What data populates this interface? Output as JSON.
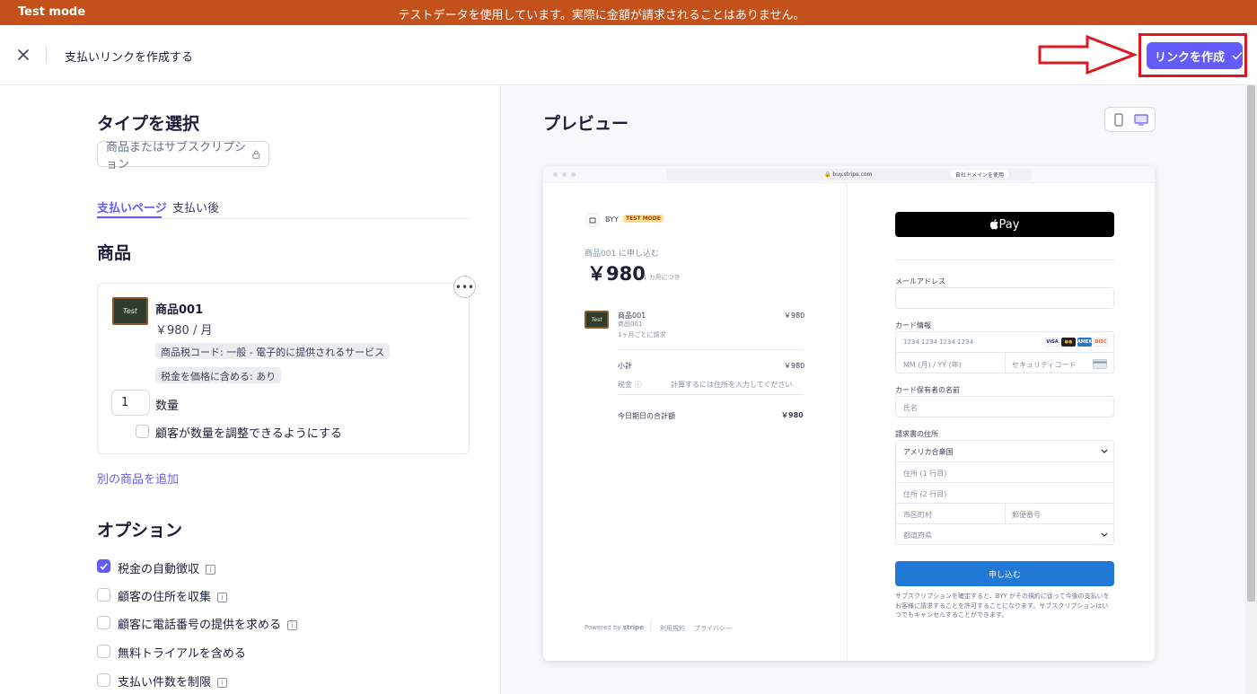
{
  "banner": {
    "mode": "Test mode",
    "message": "テストデータを使用しています。実際に金額が請求されることはありません。"
  },
  "header": {
    "title": "支払いリンクを作成する",
    "create_button": "リンクを作成"
  },
  "left": {
    "type_heading": "タイプを選択",
    "type_chip": "商品またはサブスクリプション",
    "tabs": [
      {
        "label": "支払いページ",
        "active": true
      },
      {
        "label": "支払い後",
        "active": false
      }
    ],
    "product_heading": "商品",
    "product": {
      "thumb_text": "Test",
      "name": "商品001",
      "price": "￥980 / 月",
      "tags": [
        "商品税コード: 一般 - 電子的に提供されるサービス",
        "税金を価格に含める: あり"
      ],
      "quantity_value": "1",
      "quantity_label": "数量",
      "adjust_quantity_label": "顧客が数量を調整できるようにする"
    },
    "add_product_link": "別の商品を追加",
    "options_heading": "オプション",
    "options": [
      {
        "label": "税金の自動徴収",
        "checked": true
      },
      {
        "label": "顧客の住所を収集",
        "checked": false
      },
      {
        "label": "顧客に電話番号の提供を求める",
        "checked": false
      },
      {
        "label": "無料トライアルを含める",
        "checked": false
      },
      {
        "label": "支払い件数を制限",
        "checked": false
      }
    ]
  },
  "preview": {
    "heading": "プレビュー",
    "browser": {
      "url": "buy.stripe.com",
      "domain_button": "自社ドメインを使用"
    },
    "checkout": {
      "merchant": "BYY",
      "test_badge": "TEST MODE",
      "subscribe_to": "商品001 に申し込む",
      "amount": "￥980",
      "per": "1 カ月につき",
      "line_name": "商品001",
      "line_sub": "商品001",
      "line_billing": "1ヶ月ごとに請求",
      "line_price": "￥980",
      "subtotal_label": "小計",
      "subtotal_value": "￥980",
      "tax_label": "税金",
      "tax_value": "計算するには住所を入力してください",
      "total_label": "今日期日の合計額",
      "total_value": "￥980",
      "powered_prefix": "Powered by",
      "powered_brand": "stripe",
      "terms_link": "利用規約",
      "privacy_link": "プライバシー",
      "apple_pay": "Pay",
      "email_label": "メールアドレス",
      "card_label": "カード情報",
      "card_number_placeholder": "1234 1234 1234 1234",
      "expiry_placeholder": "MM (月) / YY (年)",
      "cvc_placeholder": "セキュリティコード",
      "cardholder_label": "カード保有者の名前",
      "cardholder_placeholder": "氏名",
      "billing_label": "請求書の住所",
      "country": "アメリカ合衆国",
      "address1": "住所 (1 行目)",
      "address2": "住所 (2 行目)",
      "city": "市区町村",
      "zip": "郵便番号",
      "state": "都道府県",
      "subscribe_button": "申し込む",
      "disclaimer": "サブスクリプションを確定すると、BYY がその規約に従って今後の支払いをお客様に請求することを許可することになります。サブスクリプションはいつでもキャンセルすることができます。",
      "card_brands": [
        "VISA",
        "MC",
        "AMEX",
        "DISC"
      ]
    }
  },
  "colors": {
    "banner": "#c4501a",
    "accent": "#635bff",
    "highlight": "#e0171f",
    "subscribe": "#1f77d6"
  }
}
